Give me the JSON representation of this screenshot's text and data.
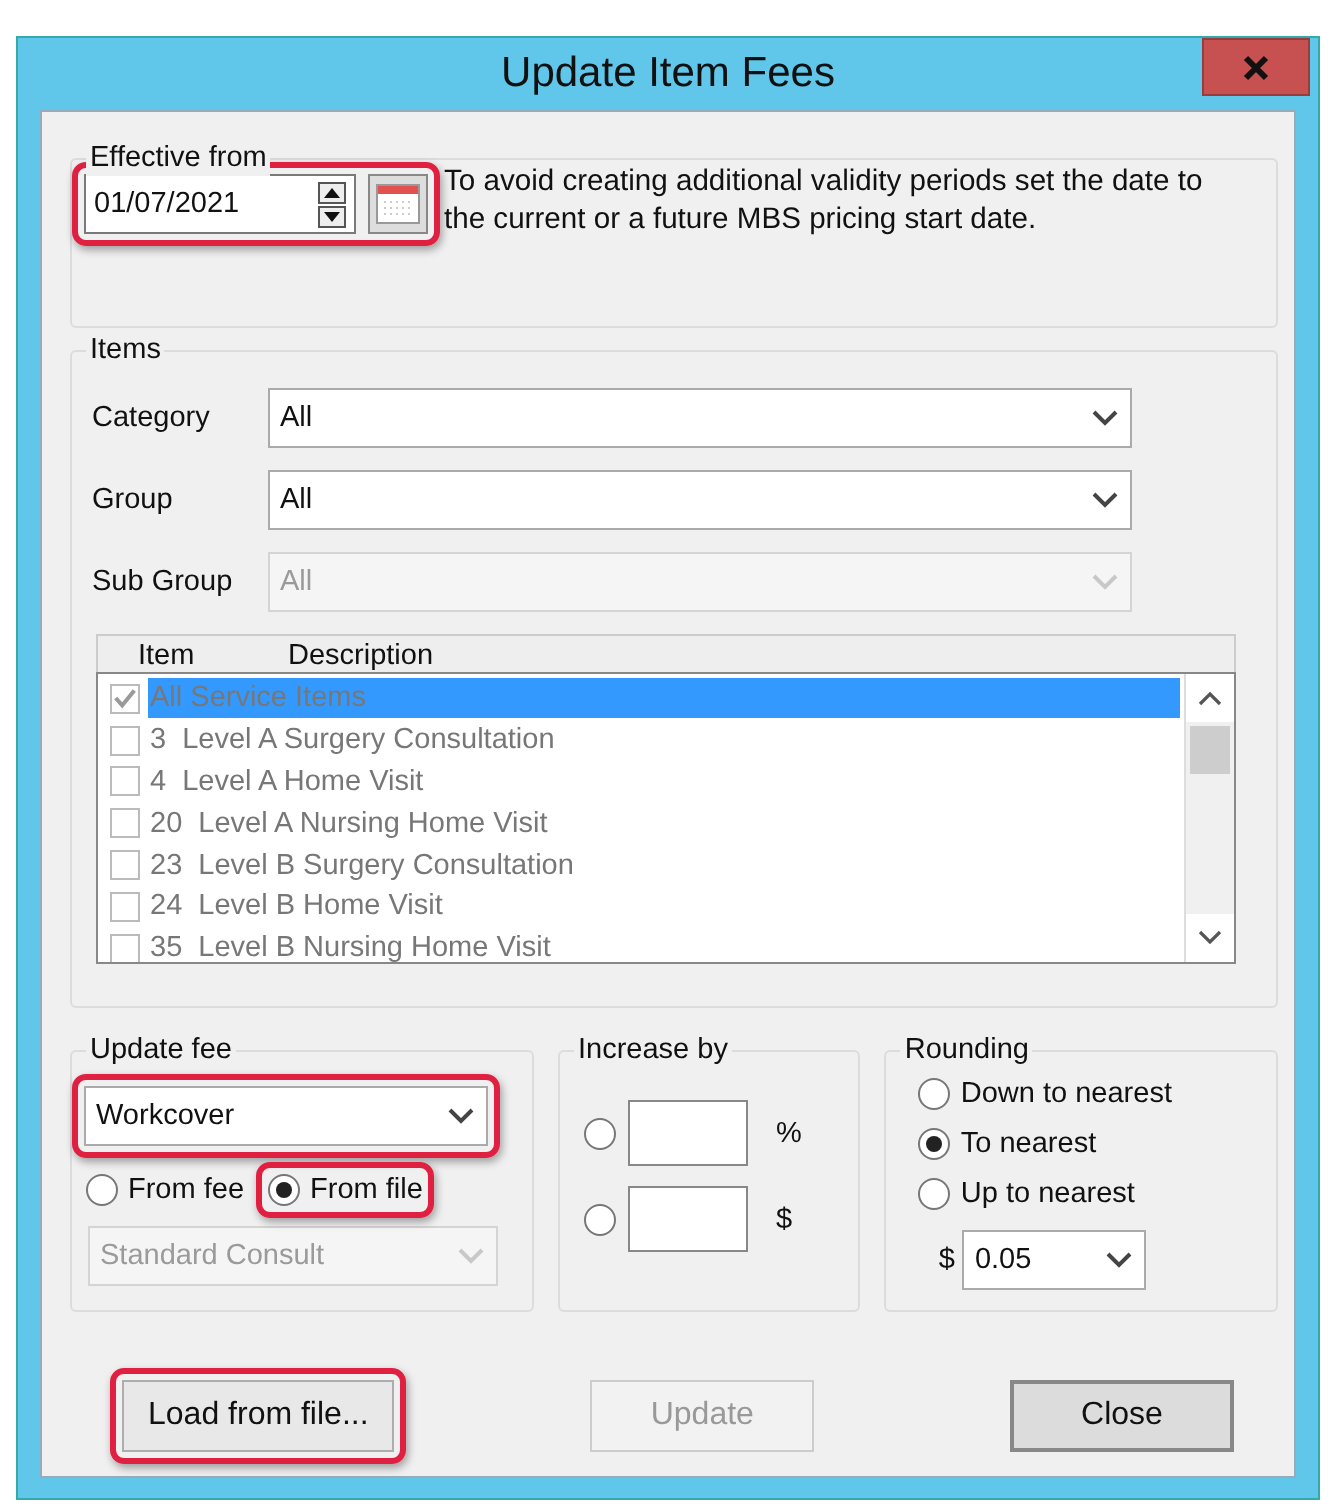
{
  "window": {
    "title": "Update Item Fees"
  },
  "effective_from": {
    "label": "Effective from",
    "date": {
      "value": "01/07/2021",
      "highlighted": true
    },
    "note": "To avoid creating additional validity periods set the date to the current or a future MBS pricing start date."
  },
  "items": {
    "label": "Items",
    "filters": [
      {
        "label": "Category",
        "value": "All",
        "disabled": false
      },
      {
        "label": "Group",
        "value": "All",
        "disabled": false
      },
      {
        "label": "Sub Group",
        "value": "All",
        "disabled": true
      }
    ],
    "list": {
      "columns": [
        "Item",
        "Description"
      ],
      "rows": [
        {
          "description": "All Service Items",
          "checked": true,
          "selected": true
        },
        {
          "item": "3",
          "description": "Level A Surgery Consultation",
          "checked": false,
          "selected": false
        },
        {
          "item": "4",
          "description": "Level A Home Visit",
          "checked": false,
          "selected": false
        },
        {
          "item": "20",
          "description": "Level A Nursing Home Visit",
          "checked": false,
          "selected": false
        },
        {
          "item": "23",
          "description": "Level B Surgery Consultation",
          "checked": false,
          "selected": false
        },
        {
          "item": "24",
          "description": "Level B Home Visit",
          "checked": false,
          "selected": false
        },
        {
          "item": "35",
          "description": "Level B Nursing Home Visit",
          "checked": false,
          "selected": false
        }
      ]
    }
  },
  "update_fee": {
    "label": "Update fee",
    "fee_type": {
      "value": "Workcover",
      "highlighted": true
    },
    "sources": [
      {
        "label": "From fee",
        "selected": false
      },
      {
        "label": "From file",
        "selected": true,
        "highlighted": true
      }
    ],
    "base_fee": {
      "value": "Standard Consult",
      "disabled": true
    }
  },
  "increase_by": {
    "label": "Increase by",
    "options": [
      {
        "unit": "%",
        "selected": false
      },
      {
        "unit": "$",
        "selected": false
      }
    ]
  },
  "rounding": {
    "label": "Rounding",
    "options": [
      {
        "label": "Down to nearest",
        "selected": false
      },
      {
        "label": "To nearest",
        "selected": true
      },
      {
        "label": "Up to nearest",
        "selected": false
      }
    ],
    "currency": "$",
    "step": "0.05"
  },
  "buttons": [
    {
      "label": "Load from file...",
      "disabled": false,
      "default": false,
      "highlighted": true
    },
    {
      "label": "Update",
      "disabled": true,
      "default": false
    },
    {
      "label": "Close",
      "disabled": false,
      "default": true
    }
  ]
}
